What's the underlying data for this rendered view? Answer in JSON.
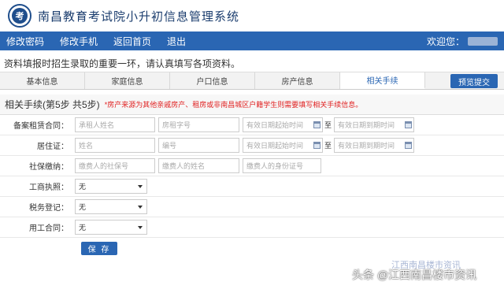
{
  "header": {
    "logo_text": "考",
    "title": "南昌教育考试院小升初信息管理系统"
  },
  "nav": {
    "items": [
      "修改密码",
      "修改手机",
      "返回首页",
      "退出"
    ],
    "welcome": "欢迎您："
  },
  "notice": "资料填报时招生录取的重要一环，请认真填写各项资料。",
  "tabs": {
    "items": [
      "基本信息",
      "家庭信息",
      "户口信息",
      "房产信息",
      "相关手续"
    ],
    "active_index": 4,
    "preview_button": "预览提交"
  },
  "step": {
    "title": "相关手续(第5步 共5步)",
    "note": "*房产来源为其他亲戚房产、租房或非南昌城区户籍学生则需要填写相关手续信息。"
  },
  "form": {
    "lease": {
      "label": "备案租赁合同：",
      "lessee_placeholder": "承租人姓名",
      "lease_no_placeholder": "房租字号",
      "start_placeholder": "有效日期起始时间",
      "to_text": "至",
      "end_placeholder": "有效日期到期时间"
    },
    "residence": {
      "label": "居住证：",
      "name_placeholder": "姓名",
      "number_placeholder": "编号",
      "start_placeholder": "有效日期起始时间",
      "to_text": "至",
      "end_placeholder": "有效日期到期时间"
    },
    "social": {
      "label": "社保缴纳：",
      "social_no_placeholder": "缴费人的社保号",
      "name_placeholder": "缴费人的姓名",
      "id_placeholder": "缴费人的身份证号"
    },
    "business": {
      "label": "工商执照：",
      "value": "无"
    },
    "tax": {
      "label": "税务登记：",
      "value": "无"
    },
    "employment": {
      "label": "用工合同：",
      "value": "无"
    },
    "save_button": "保 存"
  },
  "watermark": {
    "top": "江西南昌楼市资讯",
    "bottom": "头条 @江西南昌楼市资讯"
  },
  "colors": {
    "primary": "#2a66b3",
    "note_red": "#e02020",
    "title": "#1b3d6e"
  }
}
